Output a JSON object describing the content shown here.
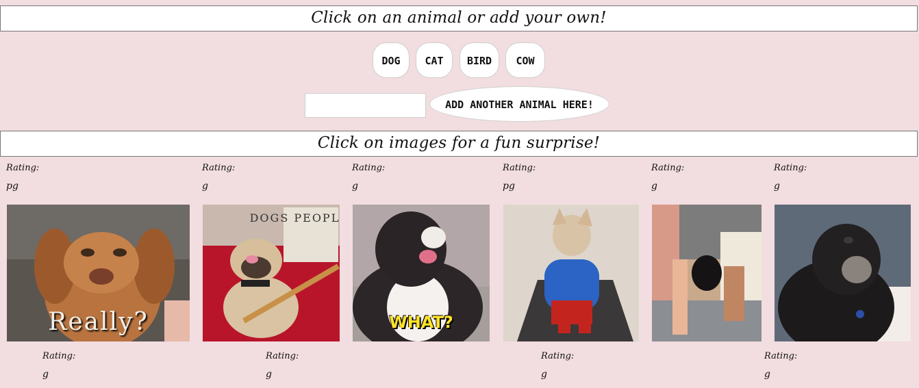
{
  "header": {
    "title": "Click on an animal or add your own!"
  },
  "animals": [
    {
      "label": "DOG"
    },
    {
      "label": "CAT"
    },
    {
      "label": "BIRD"
    },
    {
      "label": "COW"
    }
  ],
  "add": {
    "input_value": "",
    "button_label": "ADD ANOTHER ANIMAL HERE!"
  },
  "subheader": {
    "title": "Click on images for a fun surprise!"
  },
  "gifs": [
    {
      "rating_label": "Rating:",
      "rating": "pg",
      "caption": "Really?"
    },
    {
      "rating_label": "Rating:",
      "rating": "g",
      "caption": ""
    },
    {
      "rating_label": "Rating:",
      "rating": "g",
      "caption": "WHAT?"
    },
    {
      "rating_label": "Rating:",
      "rating": "pg",
      "caption": ""
    },
    {
      "rating_label": "Rating:",
      "rating": "g",
      "caption": ""
    },
    {
      "rating_label": "Rating:",
      "rating": "g",
      "caption": ""
    }
  ],
  "book_text": "DOGS PEOPLE",
  "next_row": [
    {
      "rating_label": "Rating:",
      "rating": "g"
    },
    {
      "rating_label": "Rating:",
      "rating": "g"
    },
    {
      "rating_label": "Rating:",
      "rating": "g"
    },
    {
      "rating_label": "Rating:",
      "rating": "g"
    }
  ]
}
